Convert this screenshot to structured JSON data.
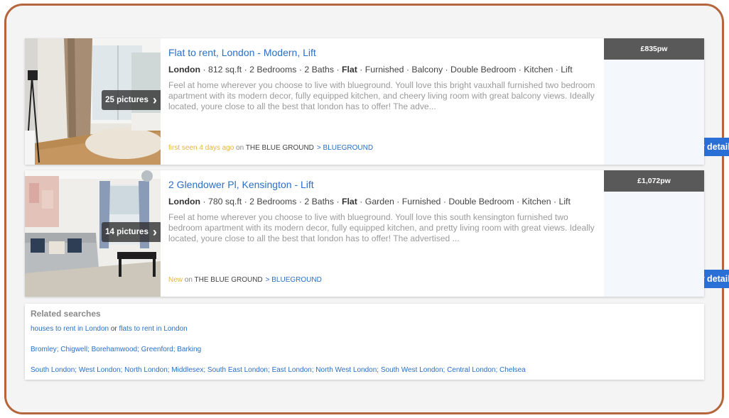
{
  "listings": [
    {
      "title": "Flat to rent, London - Modern, Lift",
      "location": "London",
      "area": " · 812 sq.ft · 2 Bedrooms · 2 Baths · ",
      "type": "Flat",
      "features": " · Furnished · Balcony · Double Bedroom · Kitchen · Lift",
      "description": "Feel at home wherever you choose to live with blueground. Youll love this bright vauxhall furnished two bedroom apartment with its modern decor, fully equipped kitchen, and cheery living room with great balcony views. Ideally located, youre close to all the best that london has to offer! The adve...",
      "seen": "first seen 4 days ago",
      "on": " on ",
      "agent": "THE BLUE GROUND",
      "sub_agent": "> BLUEGROUND",
      "pictures": "25 pictures",
      "button": "View details",
      "price": "£835pw"
    },
    {
      "title": "2 Glendower Pl, Kensington - Lift",
      "location": "London",
      "area": " · 780 sq.ft · 2 Bedrooms · 2 Baths · ",
      "type": "Flat",
      "features": " · Garden · Furnished · Double Bedroom · Kitchen · Lift",
      "description": "Feel at home wherever you choose to live with blueground. Youll love this south kensington furnished two bedroom apartment with its modern decor, fully equipped kitchen, and pretty living room with great views. Ideally located, youre close to all the best that london has to offer! The advertised ...",
      "seen": "New",
      "on": " on ",
      "agent": "THE BLUE GROUND",
      "sub_agent": "> BLUEGROUND",
      "pictures": "14 pictures",
      "button": "View details",
      "price": "£1,072pw"
    }
  ],
  "related": {
    "heading": "Related searches",
    "line1": {
      "a": "houses to rent in London",
      "or": " or ",
      "b": "flats to rent in London"
    },
    "line2": [
      "Bromley",
      "Chigwell",
      "Borehamwood",
      "Greenford",
      "Barking"
    ],
    "line3": [
      "South London",
      "West London",
      "North London",
      "Middlesex",
      "South East London",
      "East London",
      "North West London",
      "South West London",
      "Central London",
      "Chelsea"
    ]
  },
  "icons": {
    "chevron": "chevron-right-icon"
  },
  "colors": {
    "accent": "#2a6fc8",
    "button": "#2a6fd6",
    "price_bg": "#595959",
    "new_badge": "#e8b540",
    "frame": "#b5653c"
  }
}
